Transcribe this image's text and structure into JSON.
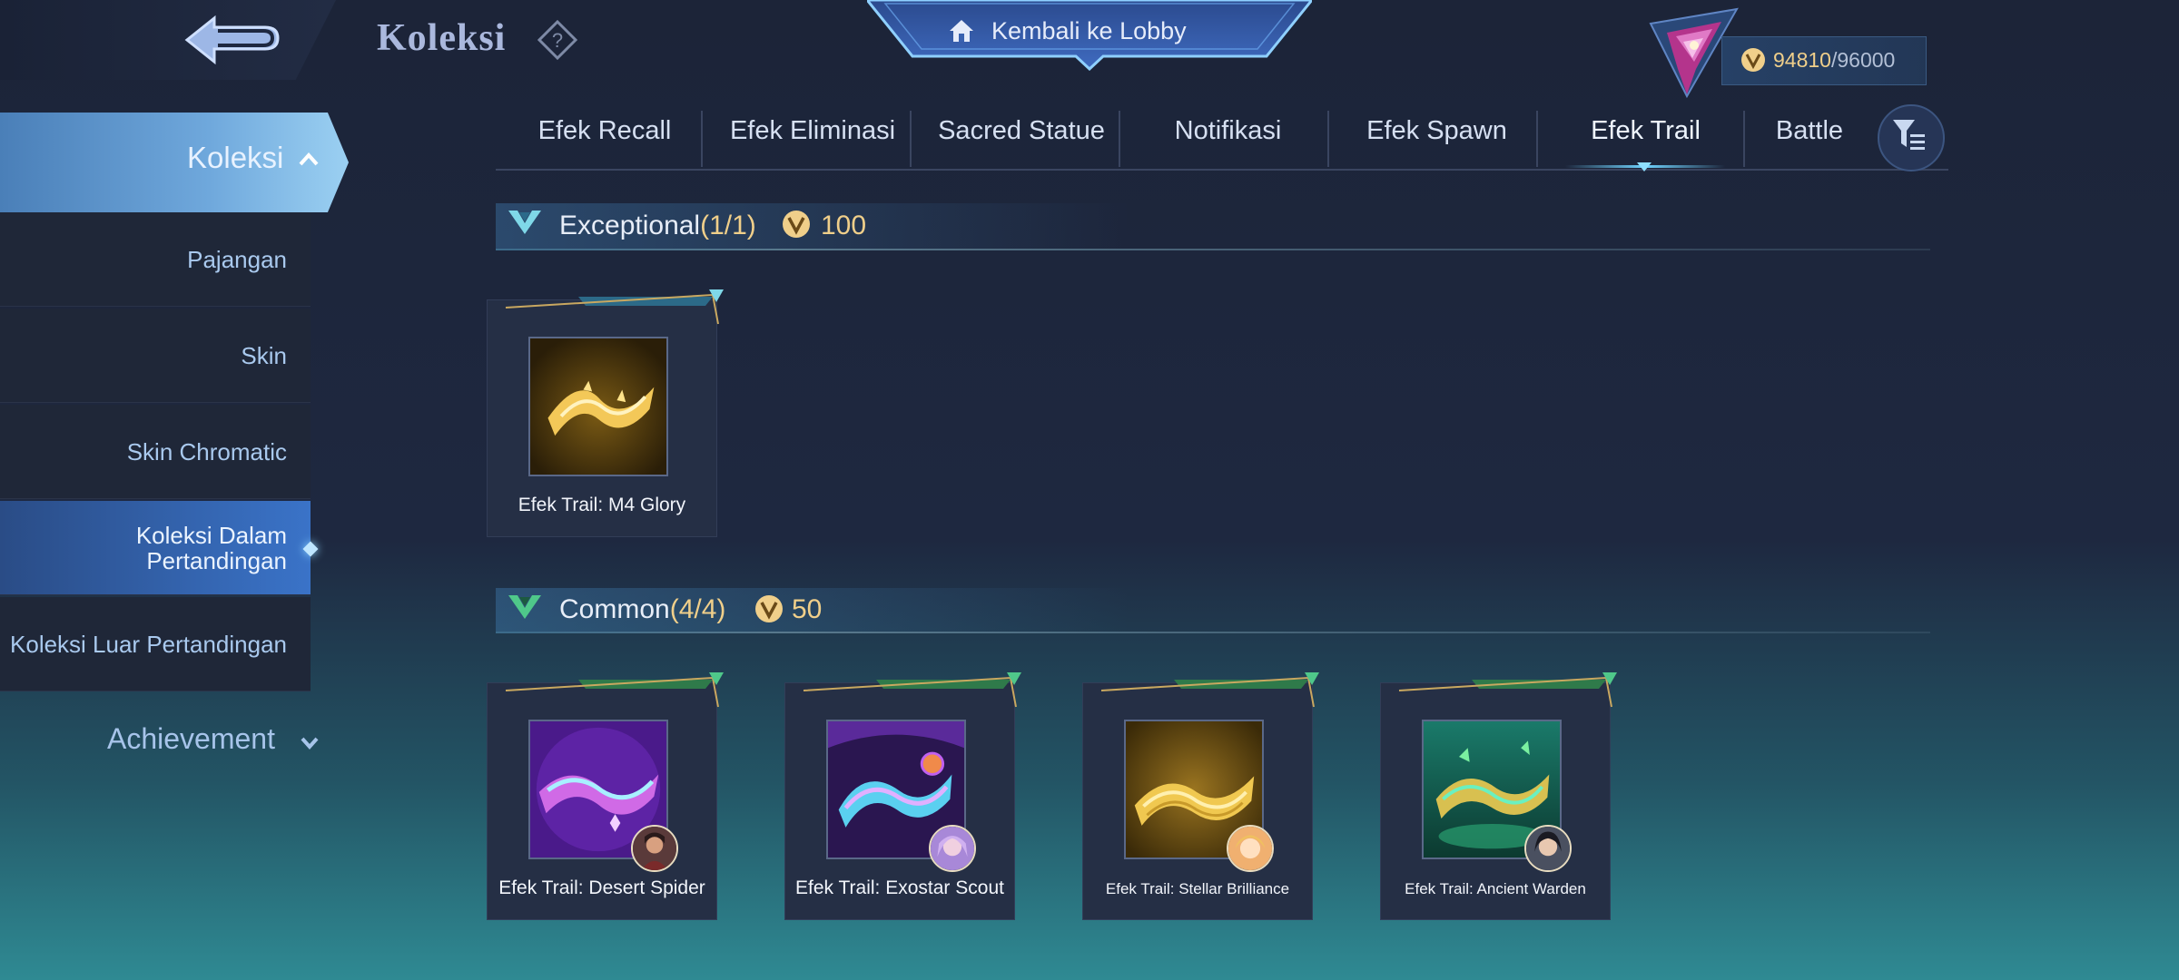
{
  "header": {
    "title": "Koleksi",
    "lobby_label": "Kembali ke Lobby",
    "points_current": "94810",
    "points_separator": "/",
    "points_max": "96000"
  },
  "sidebar": {
    "main_label": "Koleksi",
    "items": [
      {
        "label": "Pajangan"
      },
      {
        "label": "Skin"
      },
      {
        "label": "Skin Chromatic"
      },
      {
        "label": "Koleksi Dalam Pertandingan",
        "active": true
      },
      {
        "label": "Koleksi Luar Pertandingan"
      }
    ],
    "achievement_label": "Achievement"
  },
  "tabs": [
    {
      "label": "Efek Recall"
    },
    {
      "label": "Efek Eliminasi"
    },
    {
      "label": "Sacred Statue"
    },
    {
      "label": "Notifikasi"
    },
    {
      "label": "Efek Spawn"
    },
    {
      "label": "Efek Trail",
      "active": true
    },
    {
      "label": "Battle"
    }
  ],
  "sections": [
    {
      "title": "Exceptional",
      "count": "(1/1)",
      "points": "100",
      "items": [
        {
          "label": "Efek Trail: M4 Glory",
          "icon": "golden-trail"
        }
      ]
    },
    {
      "title": "Common",
      "count": "(4/4)",
      "points": "50",
      "items": [
        {
          "label": "Efek Trail: Desert Spider",
          "icon": "purple-trail"
        },
        {
          "label": "Efek Trail: Exostar Scout",
          "icon": "cosmic-trail"
        },
        {
          "label": "Efek Trail: Stellar Brilliance",
          "icon": "gold-wave-trail"
        },
        {
          "label": "Efek Trail: Ancient Warden",
          "icon": "green-trail"
        }
      ]
    }
  ],
  "colors": {
    "accent_gold": "#f0cf8a",
    "tab_highlight": "#6fd3ff",
    "sidebar_active": "#3a73c8"
  }
}
